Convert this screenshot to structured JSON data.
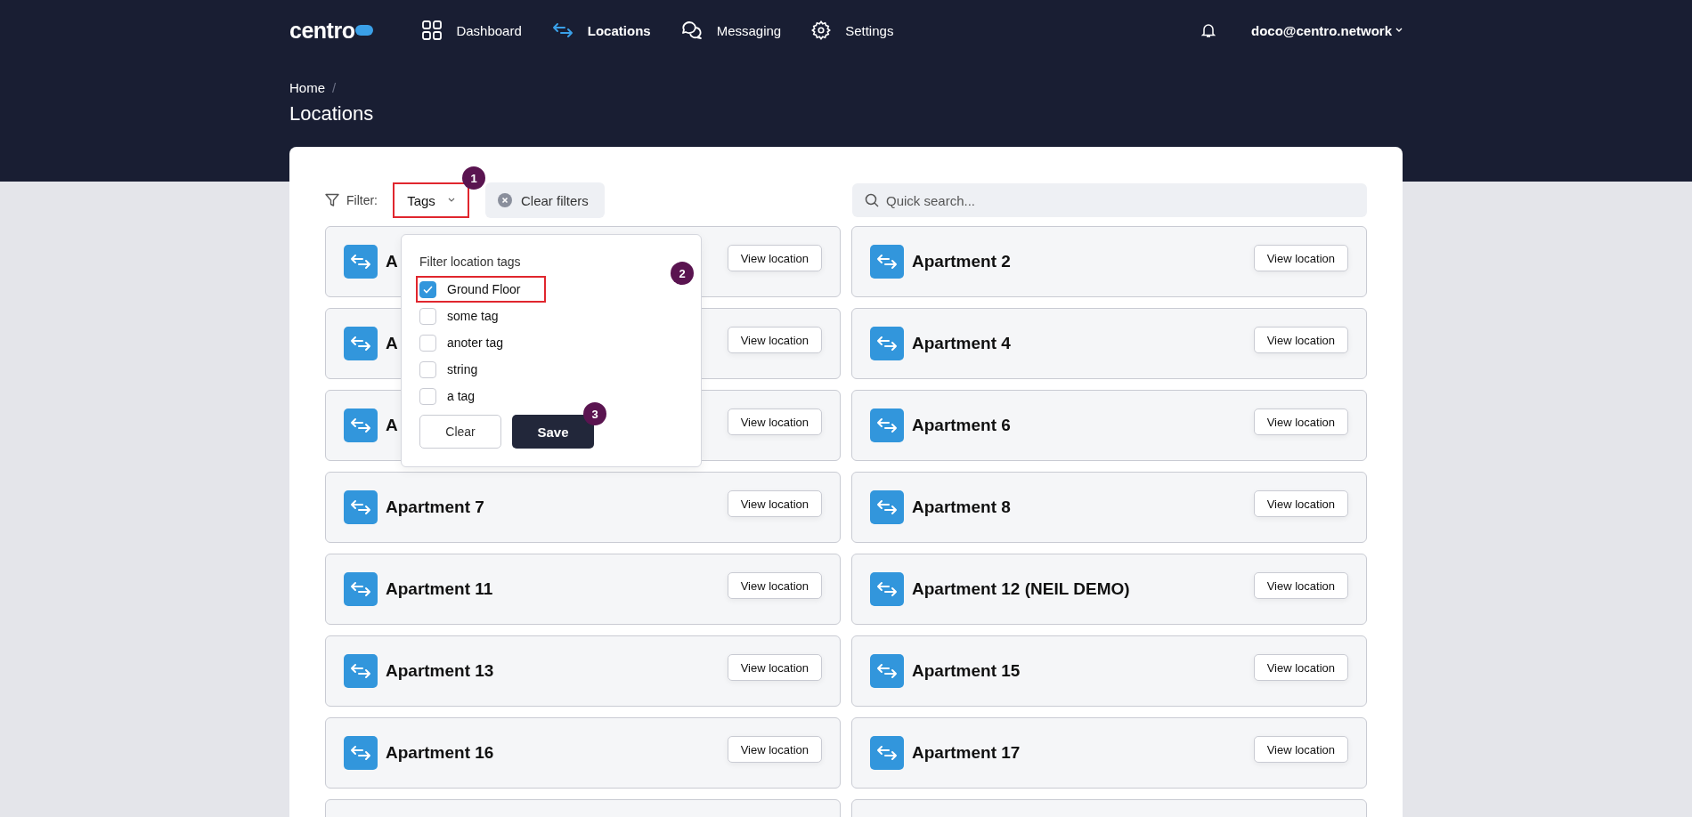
{
  "nav": {
    "logo": "centro",
    "items": [
      {
        "label": "Dashboard",
        "selected": false
      },
      {
        "label": "Locations",
        "selected": true
      },
      {
        "label": "Messaging",
        "selected": false
      },
      {
        "label": "Settings",
        "selected": false
      }
    ],
    "user": "doco@centro.network"
  },
  "breadcrumb": {
    "items": [
      "Home"
    ],
    "separator": "/"
  },
  "page_title": "Locations",
  "filter": {
    "label": "Filter:",
    "tags_button": {
      "label": "Tags",
      "highlighted": true,
      "step": "1"
    },
    "clear_filters": "Clear filters",
    "search": {
      "placeholder": "Quick search..."
    }
  },
  "tag_menu": {
    "title": "Filter location tags",
    "options": [
      {
        "label": "Ground Floor",
        "checked": true,
        "highlighted": true,
        "step": "2"
      },
      {
        "label": "some tag",
        "checked": false,
        "highlighted": false
      },
      {
        "label": "anoter tag",
        "checked": false,
        "highlighted": false
      },
      {
        "label": "string",
        "checked": false,
        "highlighted": false
      },
      {
        "label": "a tag",
        "checked": false,
        "highlighted": false
      }
    ],
    "clear": "Clear",
    "save": {
      "label": "Save",
      "step": "3"
    }
  },
  "locations": [
    {
      "kind": "card",
      "name": "A",
      "button": "View location"
    },
    {
      "kind": "card",
      "name": "Apartment 2",
      "button": "View location"
    },
    {
      "kind": "card",
      "name": "A",
      "button": "View location"
    },
    {
      "kind": "card",
      "name": "Apartment 4",
      "button": "View location"
    },
    {
      "kind": "card",
      "name": "A",
      "button": "View location"
    },
    {
      "kind": "card",
      "name": "Apartment 6",
      "button": "View location"
    },
    {
      "kind": "card",
      "name": "Apartment 7",
      "button": "View location"
    },
    {
      "kind": "card",
      "name": "Apartment 8",
      "button": "View location"
    },
    {
      "kind": "card",
      "name": "Apartment 11",
      "button": "View location"
    },
    {
      "kind": "card",
      "name": "Apartment 12 (NEIL DEMO)",
      "button": "View location"
    },
    {
      "kind": "card",
      "name": "Apartment 13",
      "button": "View location"
    },
    {
      "kind": "card",
      "name": "Apartment 15",
      "button": "View location"
    },
    {
      "kind": "card",
      "name": "Apartment 16",
      "button": "View location"
    },
    {
      "kind": "card",
      "name": "Apartment 17",
      "button": "View location"
    },
    {
      "kind": "cut"
    },
    {
      "kind": "cut"
    }
  ]
}
